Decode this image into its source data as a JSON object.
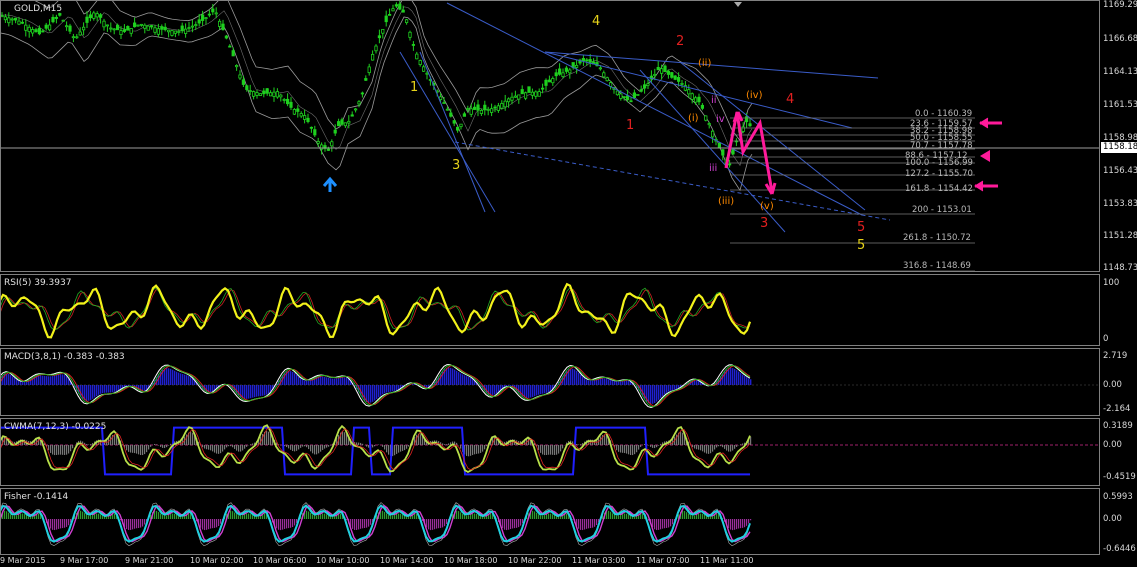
{
  "main": {
    "symbol_label": "GOLD,M15",
    "price_ticks": [
      "1169.29",
      "1166.68",
      "1164.13",
      "1161.53",
      "1158.98",
      "1156.43",
      "1153.83",
      "1151.28",
      "1148.73"
    ],
    "current_price": "1158.18",
    "wave_labels": [
      {
        "text": "4",
        "color": "#e5d21a"
      },
      {
        "text": "1",
        "color": "#e5d21a"
      },
      {
        "text": "3",
        "color": "#e5d21a"
      },
      {
        "text": "2",
        "color": "#e02020"
      },
      {
        "text": "1",
        "color": "#e02020"
      },
      {
        "text": "(ii)",
        "color": "#ff8a00"
      },
      {
        "text": "(iv)",
        "color": "#ff8a00"
      },
      {
        "text": "4",
        "color": "#e02020"
      },
      {
        "text": "(i)",
        "color": "#ff8a00"
      },
      {
        "text": "ii",
        "color": "#d040d0"
      },
      {
        "text": "iv",
        "color": "#d040d0"
      },
      {
        "text": "iii",
        "color": "#d040d0"
      },
      {
        "text": "(iii)",
        "color": "#ff8a00"
      },
      {
        "text": "(v)",
        "color": "#ff8a00"
      },
      {
        "text": "3",
        "color": "#e02020"
      },
      {
        "text": "5",
        "color": "#e02020"
      },
      {
        "text": "5",
        "color": "#e5d21a"
      }
    ],
    "fib_levels": [
      "0.0 - 1160.39",
      "23.6 - 1159.57",
      "38.2 - 1158.98",
      "50.0 - 1158.55",
      "70.7 - 1157.78",
      "88.6 - 1157.12",
      "100.0 - 1156.99",
      "127.2 - 1155.70",
      "161.8 - 1154.42",
      "200 - 1153.01",
      "261.8 - 1150.72",
      "316.8 - 1148.69"
    ]
  },
  "rsi": {
    "label": "RSI(5) 39.3937",
    "ticks": [
      "100",
      "0"
    ]
  },
  "macd": {
    "label": "MACD(3,8,1) -0.383 -0.383",
    "ticks": [
      "2.719",
      "0.00",
      "-2.164"
    ]
  },
  "cwma": {
    "label": "CWMA(7,12,3) -0.0225",
    "ticks": [
      "0.3189",
      "0.00",
      "-0.4519"
    ]
  },
  "fisher": {
    "label": "Fisher -0.1414",
    "ticks": [
      "0.5993",
      "0.00",
      "-0.6446"
    ]
  },
  "time_labels": [
    "9 Mar 2015",
    "9 Mar 17:00",
    "9 Mar 21:00",
    "10 Mar 02:00",
    "10 Mar 06:00",
    "10 Mar 10:00",
    "10 Mar 14:00",
    "10 Mar 18:00",
    "10 Mar 22:00",
    "11 Mar 03:00",
    "11 Mar 07:00",
    "11 Mar 11:00"
  ],
  "colors": {
    "candle_up": "#1fd01f",
    "candle_down": "#1fd01f",
    "bands": "#9a9a9a",
    "trendline": "#3a5cc8",
    "pink": "#ff1a9a",
    "arrow_up": "#1e90ff",
    "rsi_line": "#f2f21a",
    "macd_hist": "#2020d0",
    "fisher_line": "#20d0e0"
  },
  "chart_data": {
    "type": "line",
    "title": "GOLD,M15",
    "x": [
      "9 Mar 2015",
      "9 Mar 17:00",
      "9 Mar 21:00",
      "10 Mar 02:00",
      "10 Mar 06:00",
      "10 Mar 10:00",
      "10 Mar 14:00",
      "10 Mar 18:00",
      "10 Mar 22:00",
      "11 Mar 03:00",
      "11 Mar 07:00",
      "11 Mar 11:00"
    ],
    "series": [
      {
        "values": [
          1168.5,
          1167.7,
          1167.3,
          1167.9,
          1163.2,
          1158.0,
          1169.3,
          1160.8,
          1162.1,
          1164.8,
          1164.3,
          1156.6
        ]
      }
    ],
    "ylim": [
      1148.73,
      1169.29
    ],
    "grid": false,
    "sub_indicators": [
      {
        "name": "RSI(5)",
        "last": 39.3937,
        "ylim": [
          0,
          100
        ]
      },
      {
        "name": "MACD(3,8,1)",
        "last": -0.383,
        "ylim": [
          -2.164,
          2.719
        ]
      },
      {
        "name": "CWMA(7,12,3)",
        "last": -0.0225,
        "ylim": [
          -0.4519,
          0.3189
        ]
      },
      {
        "name": "Fisher",
        "last": -0.1414,
        "ylim": [
          -0.6446,
          0.5993
        ]
      }
    ]
  }
}
